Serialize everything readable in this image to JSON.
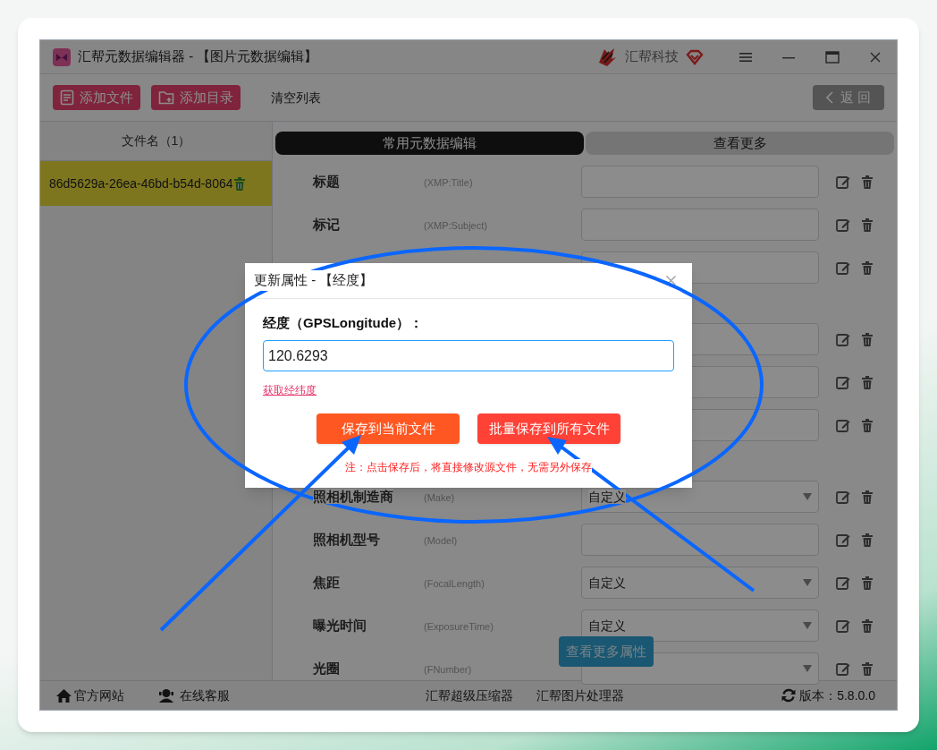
{
  "window": {
    "title": "汇帮元数据编辑器 - 【图片元数据编辑】",
    "brand": "汇帮科技"
  },
  "toolbar": {
    "buttons": [
      {
        "label": "添加文件",
        "kind": "file"
      },
      {
        "label": "添加目录",
        "kind": "folder"
      },
      {
        "label": "清空列表",
        "kind": "text"
      }
    ],
    "back": "返 回"
  },
  "file_list": {
    "header": "文件名（1）",
    "items": [
      {
        "name": "86d5629a-26ea-46bd-b54d-8064",
        "selected": true
      }
    ]
  },
  "tabs": [
    {
      "label": "常用元数据编辑",
      "selected": true
    },
    {
      "label": "查看更多",
      "selected": false
    }
  ],
  "field_groups": [
    [
      {
        "label": "标题",
        "key": "(XMP:Title)",
        "kind": "input"
      },
      {
        "label": "标记",
        "key": "(XMP:Subject)",
        "kind": "input"
      },
      {
        "kind": "input"
      }
    ],
    [
      {
        "kind": "input"
      },
      {
        "kind": "input"
      },
      {
        "kind": "input"
      }
    ],
    [
      {
        "label": "照相机制造商",
        "key": "(Make)",
        "kind": "select",
        "value": "自定义"
      },
      {
        "label": "照相机型号",
        "key": "(Model)",
        "kind": "input"
      },
      {
        "label": "焦距",
        "key": "(FocalLength)",
        "kind": "select",
        "value": "自定义"
      },
      {
        "label": "曝光时间",
        "key": "(ExposureTime)",
        "kind": "select",
        "value": "自定义"
      },
      {
        "label": "光圈",
        "key": "(FNumber)",
        "kind": "select"
      }
    ]
  ],
  "more_button": "查看更多属性",
  "footer": {
    "links": [
      {
        "label": "官方网站",
        "kind": "home"
      },
      {
        "label": "在线客服",
        "kind": "support"
      }
    ],
    "apps": [
      "汇帮超级压缩器",
      "汇帮图片处理器"
    ],
    "version": "版本：5.8.0.0"
  },
  "dialog": {
    "title": "更新属性 - 【经度】",
    "field_label": "经度（GPSLongitude）：",
    "value": "120.6293",
    "link": "获取经纬度",
    "buttons": [
      {
        "label": "保存到当前文件",
        "kind": "primary"
      },
      {
        "label": "批量保存到所有文件",
        "kind": "batch"
      }
    ],
    "note": "注：点击保存后，将直接修改源文件，无需另外保存"
  }
}
